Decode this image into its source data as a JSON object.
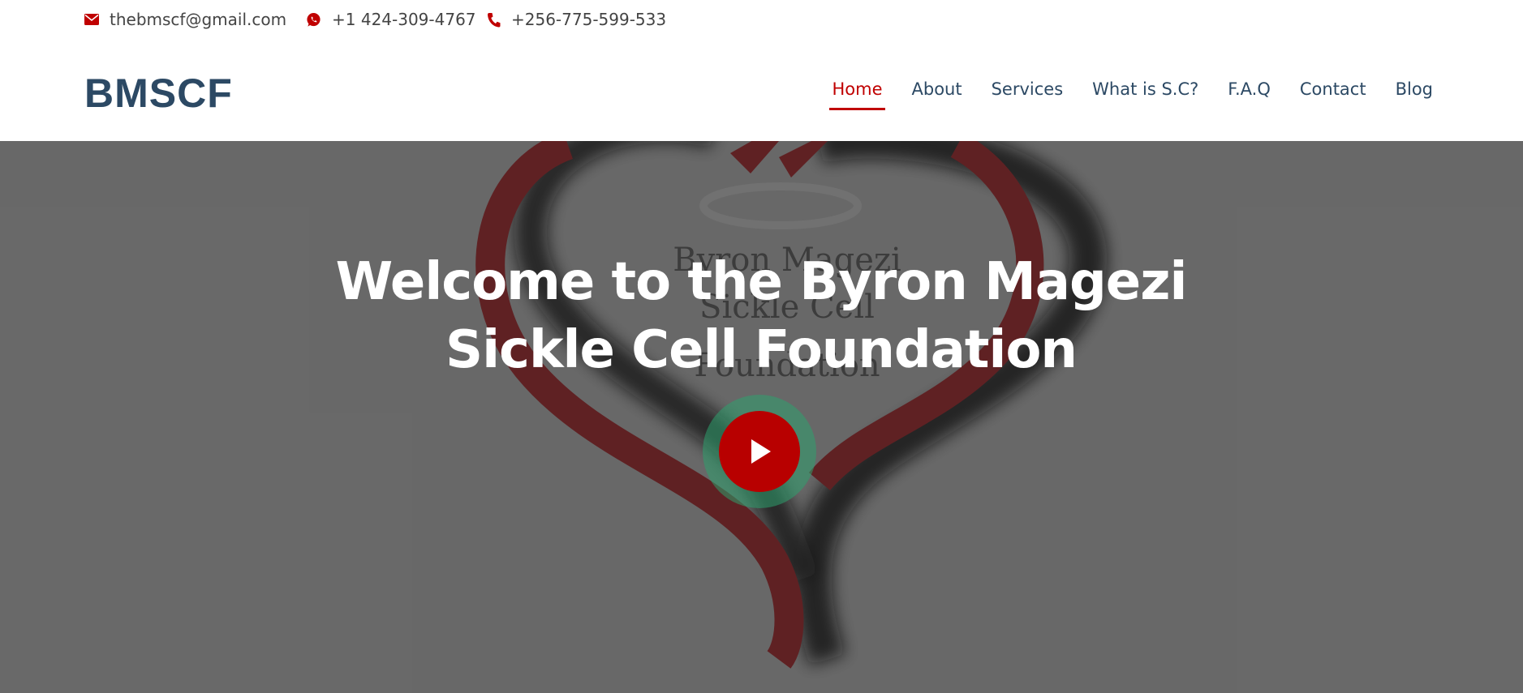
{
  "topbar": {
    "email": "thebmscf@gmail.com",
    "whatsapp": "+1 424-309-4767",
    "phone": "+256-775-599-533",
    "icons": [
      "envelope-icon",
      "whatsapp-icon",
      "phone-icon"
    ],
    "icon_color": "#c00000"
  },
  "header": {
    "logo": "BMSCF",
    "nav": [
      {
        "label": "Home",
        "active": true
      },
      {
        "label": "About"
      },
      {
        "label": "Services"
      },
      {
        "label": "What is S.C?"
      },
      {
        "label": "F.A.Q"
      },
      {
        "label": "Contact"
      },
      {
        "label": "Blog"
      }
    ]
  },
  "hero": {
    "title_line1": "Welcome to the Byron Magezi",
    "title_line2": "Sickle Cell Foundation",
    "background_logo_text": [
      "Byron Magezi",
      "Sickle Cell",
      "Foundation"
    ],
    "play_button_icon": "play-icon"
  },
  "colors": {
    "brand_navy": "#2c4964",
    "accent_red": "#c00000",
    "play_ring": "#2ea06e"
  }
}
